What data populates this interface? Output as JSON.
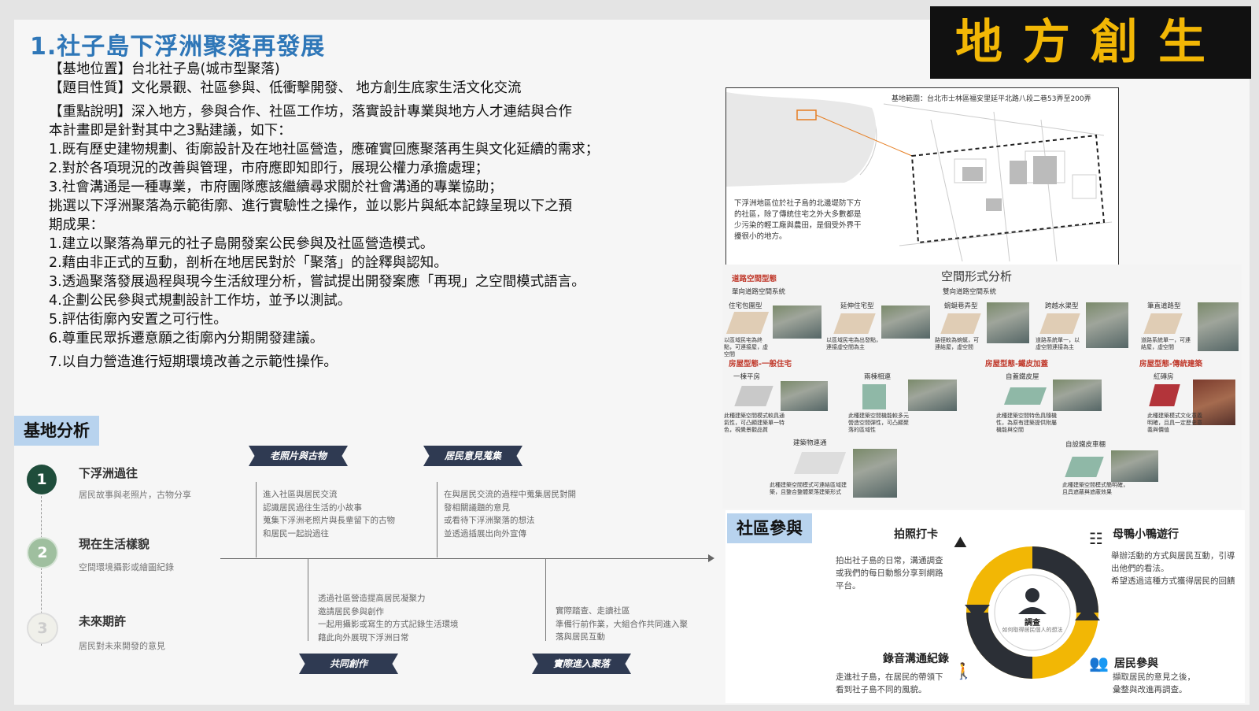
{
  "banner": {
    "text": "地方創生"
  },
  "title": "1.社子島下浮洲聚落再發展",
  "intro_lines": [
    "【基地位置】台北社子島(城市型聚落)",
    "【題目性質】文化景觀、社區參與、低衝擊開發、 地方創生底家生活文化交流",
    "【重點說明】深入地方，參與合作、社區工作坊，落實設計專業與地方人才連結與合作",
    "本計畫即是針對其中之3點建議，如下：",
    "1.既有歷史建物規劃、街廓設計及在地社區營造，應確實回應聚落再生與文化延續的需求；",
    "2.對於各項現況的改善與管理，市府應即知即行，展現公權力承擔處理；",
    "3.社會溝通是一種專業，市府團隊應該繼續尋求關於社會溝通的專業協助；",
    "挑選以下浮洲聚落為示範街廓、進行實驗性之操作，並以影片與紙本記錄呈現以下之預",
    "期成果：",
    "1.建立以聚落為單元的社子島開發案公民參與及社區營造模式。",
    "2.藉由非正式的互動，剖析在地居民對於「聚落」的詮釋與認知。",
    "3.透過聚落發展過程與現今生活紋理分析，嘗試提出開發案應「再現」之空間模式語言。",
    "4.企劃公民參與式規劃設計工作坊，並予以測試。",
    "5.評估街廓內安置之可行性。",
    "6.尊重民眾拆遷意願之街廓內分期開發建議。",
    "7.以自力營造進行短期環境改善之示範性操作。"
  ],
  "map": {
    "title": "基地範圍：台北市士林區福安里延平北路八段二巷53弄至200弄",
    "caption": "下浮洲地區位於社子島的北邊堤防下方的社區，除了傳統住宅之外大多數都是少污染的輕工廠與農田，是個受外界干擾很小的地方。"
  },
  "spatial": {
    "title": "空間形式分析",
    "road_heading": "道路空間型態",
    "road_sub1": "單向道路空間系統",
    "road_sub2": "雙向道路空間系統",
    "road_types": [
      {
        "name": "住宅包圍型",
        "note": "以區域民宅為終點，可連接屋，虛空間"
      },
      {
        "name": "延伸住宅型",
        "note": "以區域民宅為出發點，連接虛空間為主"
      },
      {
        "name": "蜿蜒巷弄型",
        "note": "路徑較為蜿蜒，可連結屋，虛空間"
      },
      {
        "name": "跨越水渠型",
        "note": "道路系統單一，以虛空間連接為主"
      },
      {
        "name": "筆直道路型",
        "note": "道路系統單一，可連結屋，虛空間"
      }
    ],
    "house_heading1": "房屋型態-一般住宅",
    "house_heading2": "房屋型態-鐵皮加蓋",
    "house_heading3": "房屋型態-傳統建築",
    "house_types": [
      {
        "name": "一棟平房",
        "note": "此種建築空間模式較具通氣性，可凸顯建築單一特色，視覺景觀品質"
      },
      {
        "name": "兩棟相連",
        "note": "此種建築空間機能較多元營造空間彈性，可凸顯聚落的區域性"
      },
      {
        "name": "自蓋鐵皮屋",
        "note": "此種建築空間特色具隨機性，為原有建築提供附屬機能與空間"
      },
      {
        "name": "紅磚房",
        "note": "此種建築模式文化意義明確，且具一定歷史意義與價值"
      },
      {
        "name": "建築物連通",
        "note": "此種建築空間模式可連結區域建築，且整合整體聚落建築形式"
      },
      {
        "name": "自設鐵皮車棚",
        "note": "此種建築空間模式簡明確，且具遮蔽與遮蔽效果"
      }
    ]
  },
  "base_analysis": {
    "label": "基地分析",
    "steps": [
      {
        "num": "1",
        "title": "下浮洲過往",
        "sub": "居民故事與老照片，古物分享"
      },
      {
        "num": "2",
        "title": "現在生活樣貌",
        "sub": "空間環境攝影或繪圖紀錄"
      },
      {
        "num": "3",
        "title": "未來期許",
        "sub": "居民對未來開發的意見"
      }
    ],
    "tags": [
      "老照片與古物",
      "居民意見蒐集",
      "共同創作",
      "實際進入聚落"
    ],
    "texts": [
      [
        "進入社區與居民交流",
        "認識居民過往生活的小故事",
        "蒐集下浮洲老照片與長輩留下的古物",
        "和居民一起說過往"
      ],
      [
        "在與居民交流的過程中蒐集居民對開",
        "發相關議題的意見",
        "或看待下浮洲聚落的想法",
        "並透過插展出向外宣傳"
      ],
      [
        "透過社區營造提高居民凝聚力",
        "邀請居民參與創作",
        "一起用攝影或寫生的方式記錄生活環境",
        "藉此向外展現下浮洲日常"
      ],
      [
        "實際踏查、走讀社區",
        "準備行前作業，大組合作共同進入聚",
        "落與居民互動"
      ]
    ]
  },
  "community": {
    "label": "社區參與",
    "center_label": "調查",
    "center_sub": "如何取得居民個人的想法",
    "items": [
      {
        "title": "拍照打卡",
        "icon": "hiker-icon",
        "lines": [
          "拍出社子島的日常，溝通調查",
          "或我們的每日動態分享到網路",
          "平台。"
        ]
      },
      {
        "title": "母鴨小鴨遊行",
        "icon": "parade-icon",
        "lines": [
          "舉辦活動的方式與居民互動，引導",
          "出他們的看法。",
          "希望透過這種方式獲得居民的回饋"
        ]
      },
      {
        "title": "錄音溝通紀錄",
        "icon": "walker-icon",
        "lines": [
          "走進社子島，在居民的帶領下",
          "看到社子島不同的風貌。"
        ]
      },
      {
        "title": "居民參與",
        "icon": "group-icon",
        "lines": [
          "擷取居民的意見之後，",
          "彙整與改進再調查。"
        ]
      }
    ]
  },
  "colors": {
    "title_blue": "#2f77b8",
    "banner_bg": "#111111",
    "banner_fg": "#f2b705",
    "ring_yellow": "#f2b705",
    "ring_dark": "#2b2f36",
    "step1": "#1f4d3b",
    "step2": "#9fbf9f",
    "step3": "#e9e9e3"
  }
}
